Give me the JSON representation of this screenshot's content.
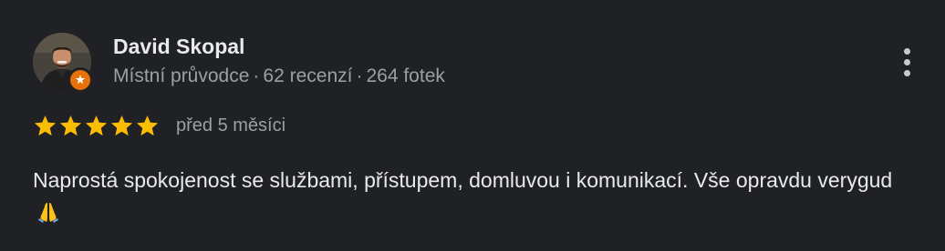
{
  "review": {
    "author_name": "David Skopal",
    "author_role": "Místní průvodce",
    "meta_separator": "·",
    "reviews_count": "62 recenzí",
    "photos_count": "264 fotek",
    "badge_icon": "local-guide-star-icon",
    "more_icon": "more-vertical-icon",
    "rating": 5,
    "rating_max": 5,
    "star_color": "#fbbc04",
    "badge_color": "#e8710a",
    "date": "před 5 měsíci",
    "text": "Naprostá spokojenost se službami, přístupem, domluvou i komunikací. Vše opravdu verygud",
    "emoji_icon": "folded-hands-icon"
  }
}
